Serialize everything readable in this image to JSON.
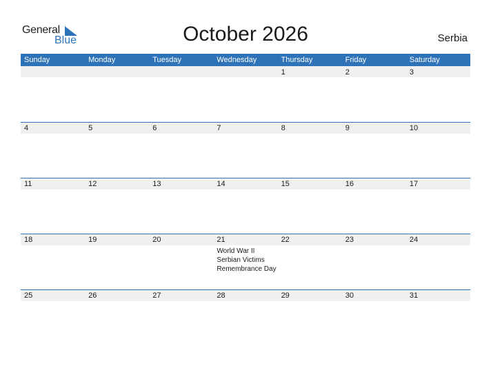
{
  "logo": {
    "general": "General",
    "blue": "Blue"
  },
  "title": "October 2026",
  "country": "Serbia",
  "colors": {
    "accent": "#2e73b8",
    "strip": "#f0f0f0"
  },
  "weekdays": [
    "Sunday",
    "Monday",
    "Tuesday",
    "Wednesday",
    "Thursday",
    "Friday",
    "Saturday"
  ],
  "weeks": [
    [
      "",
      "",
      "",
      "",
      "1",
      "2",
      "3"
    ],
    [
      "4",
      "5",
      "6",
      "7",
      "8",
      "9",
      "10"
    ],
    [
      "11",
      "12",
      "13",
      "14",
      "15",
      "16",
      "17"
    ],
    [
      "18",
      "19",
      "20",
      "21",
      "22",
      "23",
      "24"
    ],
    [
      "25",
      "26",
      "27",
      "28",
      "29",
      "30",
      "31"
    ]
  ],
  "events": [
    {
      "week": 3,
      "day": 3,
      "lines": [
        "World War II",
        "Serbian Victims",
        "Remembrance Day"
      ]
    }
  ]
}
